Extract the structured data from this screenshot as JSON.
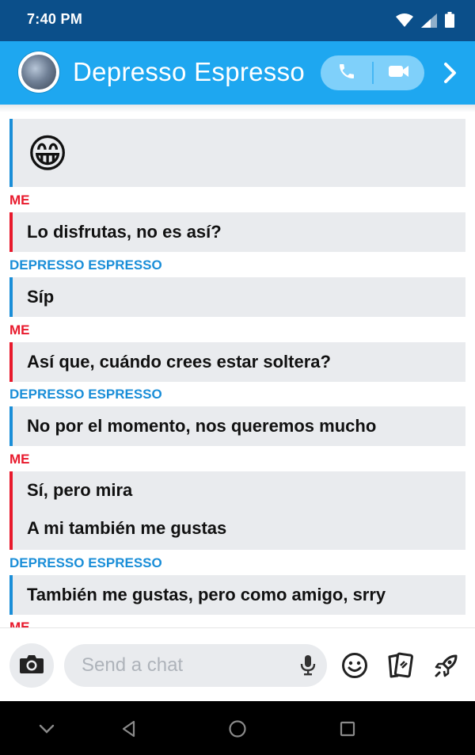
{
  "status_bar": {
    "time": "7:40 PM"
  },
  "header": {
    "contact_name": "Depresso Espresso"
  },
  "messages": [
    {
      "sender": "",
      "text": "😁"
    },
    {
      "sender": "ME",
      "text": "Lo disfrutas, no es así?"
    },
    {
      "sender": "DEPRESSO ESPRESSO",
      "text": "Síp"
    },
    {
      "sender": "ME",
      "text": "Así que, cuándo crees estar soltera?"
    },
    {
      "sender": "DEPRESSO ESPRESSO",
      "text": "No por el momento, nos queremos mucho"
    },
    {
      "sender": "ME",
      "text": "Sí, pero mira",
      "text2": "A mi también me gustas"
    },
    {
      "sender": "DEPRESSO ESPRESSO",
      "text": "También me gustas, pero como amigo, srry"
    },
    {
      "sender": "ME",
      "text": ""
    }
  ],
  "input": {
    "placeholder": "Send a chat"
  },
  "colors": {
    "header": "#1EA7F0",
    "status_bar": "#0B4F8A",
    "me": "#E8192C",
    "them": "#1A8ED8",
    "bubble": "#E9EBEE"
  },
  "icons": [
    "wifi-icon",
    "signal-icon",
    "battery-icon",
    "phone-icon",
    "video-icon",
    "chevron-right-icon",
    "camera-icon",
    "microphone-icon",
    "smiley-icon",
    "cards-icon",
    "rocket-icon",
    "back-nav-icon",
    "home-nav-icon",
    "recents-nav-icon"
  ]
}
